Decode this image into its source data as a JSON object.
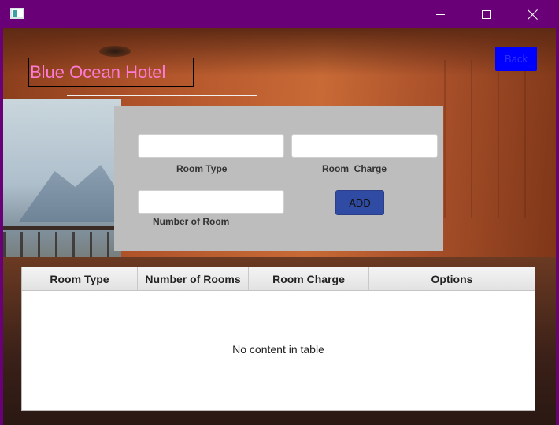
{
  "window": {
    "minimize_icon": "minimize-icon",
    "maximize_icon": "maximize-icon",
    "close_icon": "close-icon"
  },
  "header": {
    "title": "Blue Ocean Hotel",
    "back_label": "Back"
  },
  "form": {
    "room_type_label": "Room Type",
    "room_charge_label": "Room  Charge",
    "number_of_room_label": "Number of Room",
    "room_type_value": "",
    "room_charge_value": "",
    "number_of_room_value": "",
    "add_label": "ADD"
  },
  "table": {
    "columns": [
      "Room Type",
      "Number of Rooms",
      "Room Charge",
      "Options"
    ],
    "rows": [],
    "empty_message": "No content in table"
  },
  "colors": {
    "titlebar": "#6a0078",
    "title_text": "#ff7ad6",
    "back_button": "#0000ff",
    "add_button": "#2f4ba3",
    "form_panel": "#bdbdbd"
  }
}
